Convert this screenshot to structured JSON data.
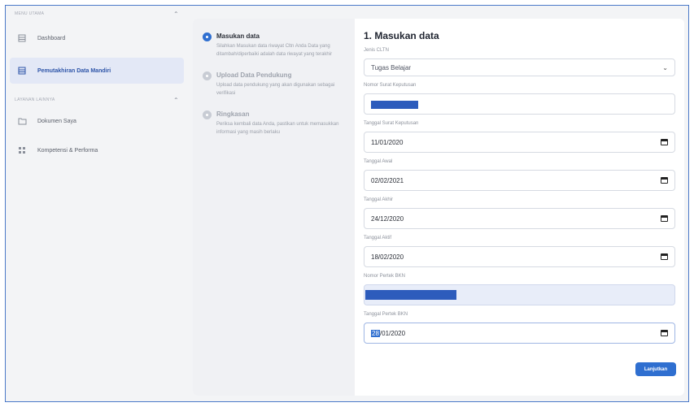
{
  "sidebar": {
    "section1": "MENU UTAMA",
    "section2": "LAYANAN LAINNYA",
    "items": [
      {
        "label": "Dashboard",
        "icon": "dashboard-icon"
      },
      {
        "label": "Pemutakhiran Data Mandiri",
        "icon": "document-icon"
      },
      {
        "label": "Dokumen Saya",
        "icon": "folder-icon"
      },
      {
        "label": "Kompetensi & Performa",
        "icon": "chart-icon"
      }
    ]
  },
  "steps": [
    {
      "title": "Masukan data",
      "desc": "Silahkan Masukan data riwayat Cltn Anda Data yang ditambah/diperbaiki adalah data riwayat yang terakhir"
    },
    {
      "title": "Upload Data Pendukung",
      "desc": "Upload data pendukung yang akan digunakan sebagai verifikasi"
    },
    {
      "title": "Ringkasan",
      "desc": "Periksa kembali data Anda, pastikan untuk memasukkan informasi yang masih berlaku"
    }
  ],
  "form": {
    "title": "1. Masukan data",
    "jenis_label": "Jenis CLTN",
    "jenis_value": "Tugas Belajar",
    "nomor_sk_label": "Nomor Surat Keputusan",
    "tgl_sk_label": "Tanggal Surat Keputusan",
    "tgl_sk_value": "11/01/2020",
    "tgl_awal_label": "Tanggal Awal",
    "tgl_awal_value": "02/02/2021",
    "tgl_akhir_label": "Tanggal Akhir",
    "tgl_akhir_value": "24/12/2020",
    "tgl_aktif_label": "Tanggal Aktif",
    "tgl_aktif_value": "18/02/2020",
    "nomor_pertek_label": "Nomor Pertek BKN",
    "tgl_pertek_label": "Tanggal Pertek BKN",
    "tgl_pertek_day": "28",
    "tgl_pertek_rest": "/01/2020",
    "button": "Lanjutkan"
  },
  "colors": {
    "accent": "#2f6fd0",
    "active_bg": "#e3e8f6",
    "redaction": "#2d5cbc"
  }
}
